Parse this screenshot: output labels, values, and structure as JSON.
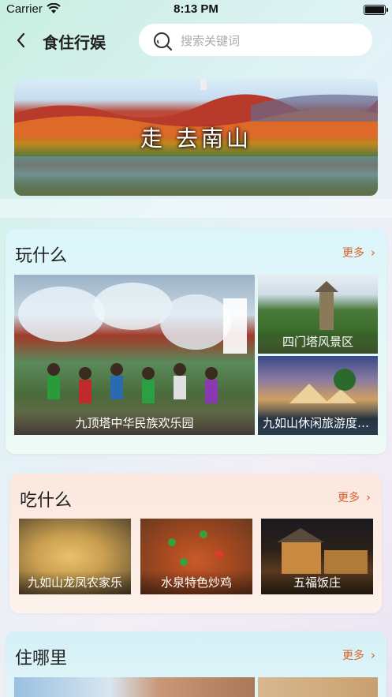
{
  "status_bar": {
    "carrier": "Carrier",
    "time": "8:13 PM"
  },
  "nav": {
    "title": "食住行娱",
    "search_placeholder": "搜索关键词"
  },
  "banner": {
    "text": "走  去南山"
  },
  "sections": {
    "play": {
      "title": "玩什么",
      "more": "更多",
      "items": [
        {
          "label": "九顶塔中华民族欢乐园"
        },
        {
          "label": "四门塔风景区"
        },
        {
          "label": "九如山休闲旅游度假区"
        }
      ]
    },
    "eat": {
      "title": "吃什么",
      "more": "更多",
      "items": [
        {
          "label": "九如山龙凤农家乐"
        },
        {
          "label": "水泉特色炒鸡"
        },
        {
          "label": "五福饭庄"
        }
      ]
    },
    "stay": {
      "title": "住哪里",
      "more": "更多"
    }
  },
  "colors": {
    "accent": "#d9622b",
    "search_bg": "#ffffff"
  }
}
